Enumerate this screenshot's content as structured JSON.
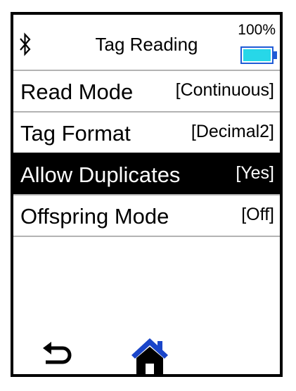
{
  "header": {
    "title": "Tag Reading",
    "battery_percent": "100%",
    "battery_level": 1.0,
    "bluetooth_icon": "bluetooth-icon",
    "battery_icon": "battery-icon"
  },
  "menu": {
    "items": [
      {
        "label": "Read Mode",
        "value": "[Continuous]",
        "selected": false
      },
      {
        "label": "Tag Format",
        "value": "[Decimal2]",
        "selected": false
      },
      {
        "label": "Allow Duplicates",
        "value": "[Yes]",
        "selected": true
      },
      {
        "label": "Offspring Mode",
        "value": "[Off]",
        "selected": false
      }
    ]
  },
  "footer": {
    "back_icon": "back-arrow-icon",
    "home_icon": "home-icon"
  },
  "colors": {
    "battery_outline": "#1f5bd6",
    "battery_fill": "#27d7e8",
    "home_icon": "#1a45c9",
    "selected_background": "#000000",
    "selected_text": "#ffffff",
    "divider": "#b3b3b3"
  }
}
